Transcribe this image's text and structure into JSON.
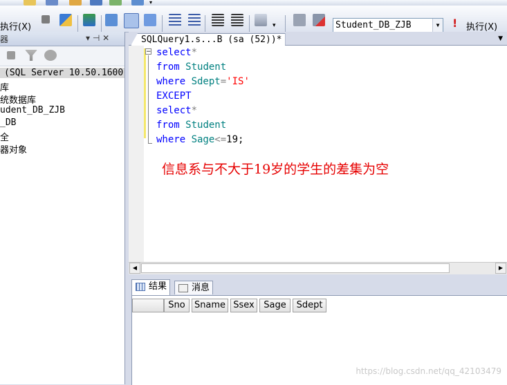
{
  "toolbar": {
    "execute_left_label": "执行(X)",
    "execute_right_label": "执行(X)",
    "database_select": "Student_DB_ZJB"
  },
  "object_explorer": {
    "title_fragment": "器",
    "pin_glyph": "▾ ⊣ ✕",
    "tree": [
      "(SQL Server 10.50.1600",
      "库",
      "统数据库",
      "udent_DB_ZJB",
      "_DB",
      "全",
      "器对象"
    ]
  },
  "editor": {
    "tab_title": "SQLQuery1.s...B (sa (52))*",
    "lines": [
      [
        {
          "t": "select",
          "c": "kw"
        },
        {
          "t": "*",
          "c": "gr"
        }
      ],
      [
        {
          "t": "from ",
          "c": "kw"
        },
        {
          "t": "Student",
          "c": "tl"
        }
      ],
      [
        {
          "t": "where ",
          "c": "kw"
        },
        {
          "t": "Sdept",
          "c": "tl"
        },
        {
          "t": "=",
          "c": "gr"
        },
        {
          "t": "'IS'",
          "c": "rd"
        }
      ],
      [
        {
          "t": "EXCEPT",
          "c": "kw"
        }
      ],
      [
        {
          "t": "select",
          "c": "kw"
        },
        {
          "t": "*",
          "c": "gr"
        }
      ],
      [
        {
          "t": "from ",
          "c": "kw"
        },
        {
          "t": "Student",
          "c": "tl"
        }
      ],
      [
        {
          "t": "where ",
          "c": "kw"
        },
        {
          "t": "Sage",
          "c": "tl"
        },
        {
          "t": "<=",
          "c": "gr"
        },
        {
          "t": "19;",
          "c": ""
        }
      ]
    ],
    "annotation": "信息系与不大于19岁的学生的差集为空"
  },
  "results": {
    "tabs": [
      "结果",
      "消息"
    ],
    "columns": [
      "Sno",
      "Sname",
      "Ssex",
      "Sage",
      "Sdept"
    ]
  },
  "watermark": "https://blog.csdn.net/qq_42103479",
  "colors": {
    "keyword": "#0000ff",
    "operator": "#808080",
    "identifier": "#008080",
    "string": "#ff0000",
    "annotation": "#e60000"
  }
}
